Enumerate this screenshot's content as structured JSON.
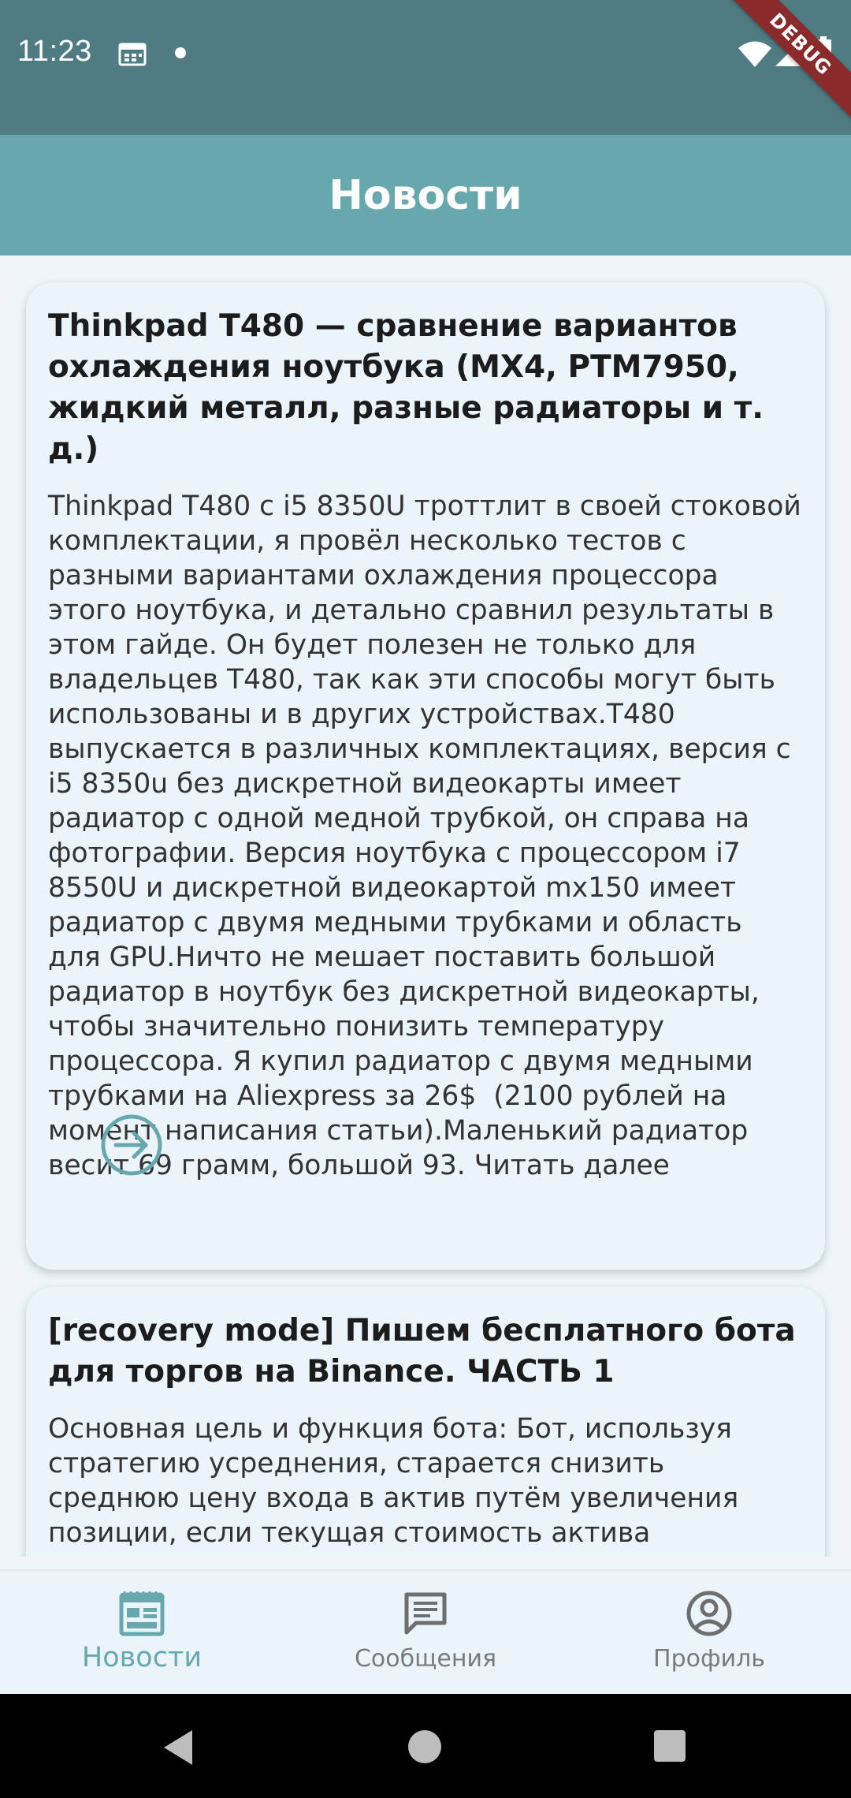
{
  "status_bar": {
    "time": "11:23",
    "debug_label": "DEBUG"
  },
  "app_bar": {
    "title": "Новости"
  },
  "articles": [
    {
      "title": "Thinkpad T480 — сравнение вариантов охлаждения ноутбука (MX4, PTM7950, жидкий металл, разные радиаторы и т. д.)",
      "body": "Thinkpad T480 с i5 8350U троттлит в своей стоковой комплектации, я провёл несколько тестов с разными вариантами охлаждения процессора этого ноутбука, и детально сравнил результаты в этом гайде. Он будет полезен не только для владельцев T480, так как эти способы могут быть использованы и в других устройствах.T480 выпускается в различных комплектациях, версия с i5 8350u без дискретной видеокарты имеет радиатор с одной медной трубкой, он справа на фотографии. Версия ноутбука с процессором i7 8550U и дискретной видеокартой mx150 имеет радиатор с двумя медными трубками и область для GPU.Ничто не мешает поставить большой радиатор в ноутбук без дискретной видеокарты, чтобы значительно понизить температуру процессора. Я купил радиатор с двумя медными трубками на Aliexpress за 26$  (2100 рублей на момент написания статьи).Маленький радиатор весит 69 грамм, большой 93. Читать далее",
      "action_icon": "arrow-right-circle-icon"
    },
    {
      "title": "[recovery mode] Пишем бесплатного бота для торгов на Binance. ЧАСТЬ 1",
      "body": "Основная цель и функция бота: Бот, используя стратегию усреднения, старается снизить среднюю цену входа в актив путём увеличения позиции, если текущая стоимость актива уменьшается по"
    }
  ],
  "bottom_nav": {
    "items": [
      {
        "label": "Новости",
        "icon": "news-icon",
        "active": true
      },
      {
        "label": "Сообщения",
        "icon": "messages-icon",
        "active": false
      },
      {
        "label": "Профиль",
        "icon": "profile-icon",
        "active": false
      }
    ]
  },
  "colors": {
    "status_bar": "#4f7b82",
    "app_bar": "#66a8ae",
    "accent": "#66a8ae",
    "background": "#eef4f9",
    "card": "#ebf3fb",
    "inactive_nav": "#7a7a7a"
  }
}
